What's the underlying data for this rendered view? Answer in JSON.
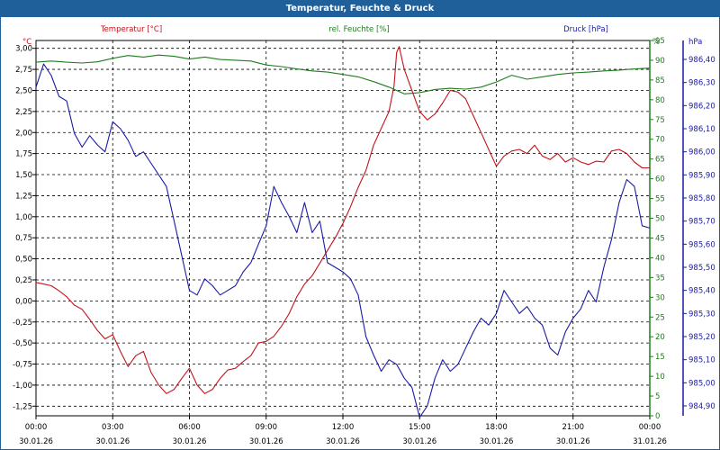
{
  "title": "Temperatur, Feuchte & Druck",
  "colors": {
    "temperature": "#c0141a",
    "humidity": "#1e7d1e",
    "pressure": "#1a1aa8",
    "header": "#1f5f9a",
    "grid": "#000000"
  },
  "chart_data": {
    "type": "line",
    "title": "Temperatur, Feuchte & Druck",
    "grid": true,
    "x_ticks": [
      {
        "time": "00:00",
        "date": "30.01.26"
      },
      {
        "time": "03:00",
        "date": "30.01.26"
      },
      {
        "time": "06:00",
        "date": "30.01.26"
      },
      {
        "time": "09:00",
        "date": "30.01.26"
      },
      {
        "time": "12:00",
        "date": "30.01.26"
      },
      {
        "time": "15:00",
        "date": "30.01.26"
      },
      {
        "time": "18:00",
        "date": "30.01.26"
      },
      {
        "time": "21:00",
        "date": "30.01.26"
      },
      {
        "time": "00:00",
        "date": "31.01.26"
      }
    ],
    "axes": {
      "temperature": {
        "label": "Temperatur [°C]",
        "unit": "°C",
        "ylim": [
          -1.375,
          3.125
        ],
        "ticks": [
          "3,00",
          "2,75",
          "2,50",
          "2,25",
          "2,00",
          "1,75",
          "1,50",
          "1,25",
          "1,00",
          "0,75",
          "0,50",
          "0,25",
          "0,00",
          "-0,25",
          "-0,50",
          "-0,75",
          "-1,00",
          "-1,25"
        ]
      },
      "humidity": {
        "label": "rel. Feuchte [%]",
        "unit": "%",
        "ylim": [
          0,
          95
        ],
        "ticks": [
          "95",
          "90",
          "85",
          "80",
          "75",
          "70",
          "65",
          "60",
          "55",
          "50",
          "45",
          "40",
          "35",
          "30",
          "25",
          "20",
          "15",
          "10",
          "5",
          "0"
        ]
      },
      "pressure": {
        "label": "Druck [hPa]",
        "unit": "hPa",
        "ylim": [
          984.8,
          986.5
        ],
        "ticks": [
          "986,40",
          "986,30",
          "986,20",
          "986,10",
          "986,00",
          "985,90",
          "985,80",
          "985,70",
          "985,60",
          "985,50",
          "985,40",
          "985,30",
          "985,20",
          "985,10",
          "985,00",
          "984,90"
        ]
      }
    },
    "series": [
      {
        "name": "Temperatur [°C]",
        "axis": "temperature",
        "points": [
          [
            0.0,
            0.22
          ],
          [
            0.3,
            0.2
          ],
          [
            0.6,
            0.18
          ],
          [
            0.9,
            0.12
          ],
          [
            1.2,
            0.05
          ],
          [
            1.5,
            -0.05
          ],
          [
            1.8,
            -0.1
          ],
          [
            2.1,
            -0.22
          ],
          [
            2.4,
            -0.35
          ],
          [
            2.7,
            -0.45
          ],
          [
            3.0,
            -0.4
          ],
          [
            3.3,
            -0.6
          ],
          [
            3.6,
            -0.78
          ],
          [
            3.9,
            -0.65
          ],
          [
            4.2,
            -0.6
          ],
          [
            4.5,
            -0.85
          ],
          [
            4.8,
            -1.0
          ],
          [
            5.1,
            -1.1
          ],
          [
            5.4,
            -1.05
          ],
          [
            5.7,
            -0.92
          ],
          [
            6.0,
            -0.8
          ],
          [
            6.3,
            -1.0
          ],
          [
            6.6,
            -1.1
          ],
          [
            6.9,
            -1.05
          ],
          [
            7.2,
            -0.92
          ],
          [
            7.5,
            -0.82
          ],
          [
            7.8,
            -0.8
          ],
          [
            8.1,
            -0.72
          ],
          [
            8.4,
            -0.65
          ],
          [
            8.7,
            -0.5
          ],
          [
            9.0,
            -0.48
          ],
          [
            9.3,
            -0.42
          ],
          [
            9.6,
            -0.3
          ],
          [
            9.9,
            -0.15
          ],
          [
            10.2,
            0.05
          ],
          [
            10.5,
            0.2
          ],
          [
            10.8,
            0.3
          ],
          [
            11.1,
            0.45
          ],
          [
            11.4,
            0.6
          ],
          [
            11.7,
            0.75
          ],
          [
            12.0,
            0.92
          ],
          [
            12.3,
            1.12
          ],
          [
            12.6,
            1.35
          ],
          [
            12.9,
            1.55
          ],
          [
            13.2,
            1.85
          ],
          [
            13.5,
            2.05
          ],
          [
            13.8,
            2.25
          ],
          [
            14.0,
            2.55
          ],
          [
            14.1,
            2.95
          ],
          [
            14.2,
            3.02
          ],
          [
            14.4,
            2.75
          ],
          [
            14.7,
            2.5
          ],
          [
            15.0,
            2.25
          ],
          [
            15.3,
            2.15
          ],
          [
            15.6,
            2.22
          ],
          [
            15.9,
            2.35
          ],
          [
            16.2,
            2.5
          ],
          [
            16.5,
            2.48
          ],
          [
            16.8,
            2.4
          ],
          [
            17.1,
            2.2
          ],
          [
            17.4,
            2.0
          ],
          [
            17.7,
            1.8
          ],
          [
            18.0,
            1.6
          ],
          [
            18.3,
            1.72
          ],
          [
            18.6,
            1.78
          ],
          [
            18.9,
            1.8
          ],
          [
            19.2,
            1.75
          ],
          [
            19.5,
            1.85
          ],
          [
            19.8,
            1.72
          ],
          [
            20.1,
            1.68
          ],
          [
            20.4,
            1.75
          ],
          [
            20.7,
            1.65
          ],
          [
            21.0,
            1.7
          ],
          [
            21.3,
            1.65
          ],
          [
            21.6,
            1.62
          ],
          [
            21.9,
            1.66
          ],
          [
            22.2,
            1.65
          ],
          [
            22.5,
            1.78
          ],
          [
            22.8,
            1.8
          ],
          [
            23.1,
            1.75
          ],
          [
            23.4,
            1.65
          ],
          [
            23.7,
            1.58
          ],
          [
            24.0,
            1.58
          ]
        ]
      },
      {
        "name": "rel. Feuchte [%]",
        "axis": "humidity",
        "points": [
          [
            0.0,
            89.5
          ],
          [
            0.6,
            89.8
          ],
          [
            1.2,
            89.5
          ],
          [
            1.8,
            89.3
          ],
          [
            2.4,
            89.6
          ],
          [
            3.0,
            90.5
          ],
          [
            3.6,
            91.2
          ],
          [
            4.2,
            90.8
          ],
          [
            4.8,
            91.3
          ],
          [
            5.4,
            91.0
          ],
          [
            6.0,
            90.3
          ],
          [
            6.6,
            90.8
          ],
          [
            7.2,
            90.2
          ],
          [
            7.8,
            90.0
          ],
          [
            8.4,
            89.8
          ],
          [
            9.0,
            88.8
          ],
          [
            9.6,
            88.4
          ],
          [
            10.2,
            87.8
          ],
          [
            10.8,
            87.3
          ],
          [
            11.4,
            87.0
          ],
          [
            12.0,
            86.4
          ],
          [
            12.6,
            85.8
          ],
          [
            13.2,
            84.6
          ],
          [
            13.8,
            83.2
          ],
          [
            14.4,
            81.5
          ],
          [
            15.0,
            81.8
          ],
          [
            15.6,
            82.6
          ],
          [
            16.2,
            82.9
          ],
          [
            16.8,
            82.7
          ],
          [
            17.4,
            83.2
          ],
          [
            18.0,
            84.5
          ],
          [
            18.6,
            86.2
          ],
          [
            19.2,
            85.2
          ],
          [
            19.8,
            85.8
          ],
          [
            20.4,
            86.4
          ],
          [
            21.0,
            86.8
          ],
          [
            21.6,
            87.0
          ],
          [
            22.2,
            87.3
          ],
          [
            22.8,
            87.5
          ],
          [
            23.4,
            87.8
          ],
          [
            24.0,
            88.0
          ]
        ]
      },
      {
        "name": "Druck [hPa]",
        "axis": "pressure",
        "points": [
          [
            0.0,
            986.28
          ],
          [
            0.3,
            986.38
          ],
          [
            0.6,
            986.33
          ],
          [
            0.9,
            986.24
          ],
          [
            1.2,
            986.22
          ],
          [
            1.5,
            986.08
          ],
          [
            1.8,
            986.02
          ],
          [
            2.1,
            986.07
          ],
          [
            2.4,
            986.03
          ],
          [
            2.7,
            986.0
          ],
          [
            3.0,
            986.13
          ],
          [
            3.3,
            986.1
          ],
          [
            3.6,
            986.05
          ],
          [
            3.9,
            985.98
          ],
          [
            4.2,
            986.0
          ],
          [
            4.5,
            985.95
          ],
          [
            4.8,
            985.9
          ],
          [
            5.1,
            985.85
          ],
          [
            5.4,
            985.7
          ],
          [
            5.7,
            985.55
          ],
          [
            6.0,
            985.4
          ],
          [
            6.3,
            985.38
          ],
          [
            6.6,
            985.45
          ],
          [
            6.9,
            985.42
          ],
          [
            7.2,
            985.38
          ],
          [
            7.5,
            985.4
          ],
          [
            7.8,
            985.42
          ],
          [
            8.1,
            985.48
          ],
          [
            8.4,
            985.52
          ],
          [
            8.7,
            985.6
          ],
          [
            9.0,
            985.68
          ],
          [
            9.3,
            985.85
          ],
          [
            9.6,
            985.78
          ],
          [
            9.9,
            985.72
          ],
          [
            10.2,
            985.65
          ],
          [
            10.5,
            985.78
          ],
          [
            10.8,
            985.65
          ],
          [
            11.1,
            985.7
          ],
          [
            11.4,
            985.52
          ],
          [
            11.7,
            985.5
          ],
          [
            12.0,
            985.48
          ],
          [
            12.3,
            985.45
          ],
          [
            12.6,
            985.38
          ],
          [
            12.9,
            985.2
          ],
          [
            13.2,
            985.12
          ],
          [
            13.5,
            985.05
          ],
          [
            13.8,
            985.1
          ],
          [
            14.1,
            985.08
          ],
          [
            14.4,
            985.02
          ],
          [
            14.7,
            984.98
          ],
          [
            15.0,
            984.85
          ],
          [
            15.3,
            984.9
          ],
          [
            15.6,
            985.02
          ],
          [
            15.9,
            985.1
          ],
          [
            16.2,
            985.05
          ],
          [
            16.5,
            985.08
          ],
          [
            16.8,
            985.15
          ],
          [
            17.1,
            985.22
          ],
          [
            17.4,
            985.28
          ],
          [
            17.7,
            985.25
          ],
          [
            18.0,
            985.3
          ],
          [
            18.3,
            985.4
          ],
          [
            18.6,
            985.35
          ],
          [
            18.9,
            985.3
          ],
          [
            19.2,
            985.33
          ],
          [
            19.5,
            985.28
          ],
          [
            19.8,
            985.25
          ],
          [
            20.1,
            985.15
          ],
          [
            20.4,
            985.12
          ],
          [
            20.7,
            985.22
          ],
          [
            21.0,
            985.28
          ],
          [
            21.3,
            985.32
          ],
          [
            21.6,
            985.4
          ],
          [
            21.9,
            985.35
          ],
          [
            22.2,
            985.5
          ],
          [
            22.5,
            985.62
          ],
          [
            22.8,
            985.78
          ],
          [
            23.1,
            985.88
          ],
          [
            23.4,
            985.85
          ],
          [
            23.7,
            985.68
          ],
          [
            24.0,
            985.67
          ]
        ]
      }
    ]
  }
}
